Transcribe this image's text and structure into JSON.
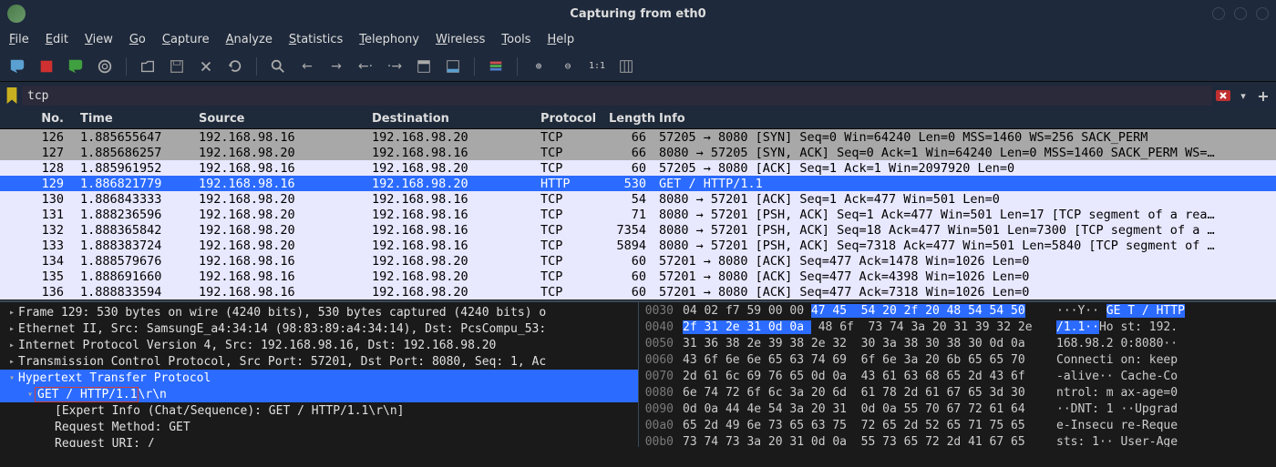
{
  "window_title": "Capturing from eth0",
  "menu": [
    "File",
    "Edit",
    "View",
    "Go",
    "Capture",
    "Analyze",
    "Statistics",
    "Telephony",
    "Wireless",
    "Tools",
    "Help"
  ],
  "menu_accel": [
    "F",
    "E",
    "V",
    "G",
    "C",
    "A",
    "S",
    "T",
    "W",
    "T",
    "H"
  ],
  "filter_value": "tcp",
  "columns": [
    "No.",
    "Time",
    "Source",
    "Destination",
    "Protocol",
    "Length",
    "Info"
  ],
  "packets": [
    {
      "no": "126",
      "time": "1.885655647",
      "src": "192.168.98.16",
      "dst": "192.168.98.20",
      "proto": "TCP",
      "len": "66",
      "info": "57205 → 8080 [SYN] Seq=0 Win=64240 Len=0 MSS=1460 WS=256 SACK_PERM",
      "cls": "bg-gray"
    },
    {
      "no": "127",
      "time": "1.885686257",
      "src": "192.168.98.20",
      "dst": "192.168.98.16",
      "proto": "TCP",
      "len": "66",
      "info": "8080 → 57205 [SYN, ACK] Seq=0 Ack=1 Win=64240 Len=0 MSS=1460 SACK_PERM WS=…",
      "cls": "bg-gray"
    },
    {
      "no": "128",
      "time": "1.885961952",
      "src": "192.168.98.16",
      "dst": "192.168.98.20",
      "proto": "TCP",
      "len": "60",
      "info": "57205 → 8080 [ACK] Seq=1 Ack=1 Win=2097920 Len=0",
      "cls": "bg-lav"
    },
    {
      "no": "129",
      "time": "1.886821779",
      "src": "192.168.98.16",
      "dst": "192.168.98.20",
      "proto": "HTTP",
      "len": "530",
      "info": "GET / HTTP/1.1 ",
      "cls": "bg-sel"
    },
    {
      "no": "130",
      "time": "1.886843333",
      "src": "192.168.98.20",
      "dst": "192.168.98.16",
      "proto": "TCP",
      "len": "54",
      "info": "8080 → 57201 [ACK] Seq=1 Ack=477 Win=501 Len=0",
      "cls": "bg-lav"
    },
    {
      "no": "131",
      "time": "1.888236596",
      "src": "192.168.98.20",
      "dst": "192.168.98.16",
      "proto": "TCP",
      "len": "71",
      "info": "8080 → 57201 [PSH, ACK] Seq=1 Ack=477 Win=501 Len=17 [TCP segment of a rea…",
      "cls": "bg-lav"
    },
    {
      "no": "132",
      "time": "1.888365842",
      "src": "192.168.98.20",
      "dst": "192.168.98.16",
      "proto": "TCP",
      "len": "7354",
      "info": "8080 → 57201 [PSH, ACK] Seq=18 Ack=477 Win=501 Len=7300 [TCP segment of a …",
      "cls": "bg-lav"
    },
    {
      "no": "133",
      "time": "1.888383724",
      "src": "192.168.98.20",
      "dst": "192.168.98.16",
      "proto": "TCP",
      "len": "5894",
      "info": "8080 → 57201 [PSH, ACK] Seq=7318 Ack=477 Win=501 Len=5840 [TCP segment of …",
      "cls": "bg-lav"
    },
    {
      "no": "134",
      "time": "1.888579676",
      "src": "192.168.98.16",
      "dst": "192.168.98.20",
      "proto": "TCP",
      "len": "60",
      "info": "57201 → 8080 [ACK] Seq=477 Ack=1478 Win=1026 Len=0",
      "cls": "bg-lav"
    },
    {
      "no": "135",
      "time": "1.888691660",
      "src": "192.168.98.16",
      "dst": "192.168.98.20",
      "proto": "TCP",
      "len": "60",
      "info": "57201 → 8080 [ACK] Seq=477 Ack=4398 Win=1026 Len=0",
      "cls": "bg-lav"
    },
    {
      "no": "136",
      "time": "1.888833594",
      "src": "192.168.98.16",
      "dst": "192.168.98.20",
      "proto": "TCP",
      "len": "60",
      "info": "57201 → 8080 [ACK] Seq=477 Ack=7318 Win=1026 Len=0",
      "cls": "bg-lav"
    }
  ],
  "details": [
    {
      "indent": 0,
      "tri": "▸",
      "text": "Frame 129: 530 bytes on wire (4240 bits), 530 bytes captured (4240 bits) o",
      "sel": false
    },
    {
      "indent": 0,
      "tri": "▸",
      "text": "Ethernet II, Src: SamsungE_a4:34:14 (98:83:89:a4:34:14), Dst: PcsCompu_53:",
      "sel": false
    },
    {
      "indent": 0,
      "tri": "▸",
      "text": "Internet Protocol Version 4, Src: 192.168.98.16, Dst: 192.168.98.20",
      "sel": false
    },
    {
      "indent": 0,
      "tri": "▸",
      "text": "Transmission Control Protocol, Src Port: 57201, Dst Port: 8080, Seq: 1, Ac",
      "sel": false
    },
    {
      "indent": 0,
      "tri": "▾",
      "text": "Hypertext Transfer Protocol",
      "sel": true,
      "hl": true
    },
    {
      "indent": 1,
      "tri": "▾",
      "text": "GET / HTTP/1.1\\r\\n",
      "sel": true,
      "hl": false,
      "red": true
    },
    {
      "indent": 2,
      "tri": "",
      "text": "[Expert Info (Chat/Sequence): GET / HTTP/1.1\\r\\n]",
      "sel": false
    },
    {
      "indent": 2,
      "tri": "",
      "text": "Request Method: GET",
      "sel": false
    },
    {
      "indent": 2,
      "tri": "",
      "text": "Request URI: /",
      "sel": false
    }
  ],
  "hex": [
    {
      "off": "0030",
      "b0": "04 02 f7 59 00 00 ",
      "bs": "47 45  54 20 2f 20 48 54 54 50",
      "a0": "···Y·· ",
      "as": "GE T / HTTP"
    },
    {
      "off": "0040",
      "b0": "",
      "bs": "2f 31 2e 31 0d 0a ",
      "b2": "48 6f  73 74 3a 20 31 39 32 2e",
      "a0": "",
      "as": "/1.1··",
      "a2": "Ho st: 192."
    },
    {
      "off": "0050",
      "b0": "31 36 38 2e 39 38 2e 32  30 3a 38 30 38 30 0d 0a",
      "a0": "168.98.2 0:8080··"
    },
    {
      "off": "0060",
      "b0": "43 6f 6e 6e 65 63 74 69  6f 6e 3a 20 6b 65 65 70",
      "a0": "Connecti on: keep"
    },
    {
      "off": "0070",
      "b0": "2d 61 6c 69 76 65 0d 0a  43 61 63 68 65 2d 43 6f",
      "a0": "-alive·· Cache-Co"
    },
    {
      "off": "0080",
      "b0": "6e 74 72 6f 6c 3a 20 6d  61 78 2d 61 67 65 3d 30",
      "a0": "ntrol: m ax-age=0"
    },
    {
      "off": "0090",
      "b0": "0d 0a 44 4e 54 3a 20 31  0d 0a 55 70 67 72 61 64",
      "a0": "··DNT: 1 ··Upgrad"
    },
    {
      "off": "00a0",
      "b0": "65 2d 49 6e 73 65 63 75  72 65 2d 52 65 71 75 65",
      "a0": "e-Insecu re-Reque"
    },
    {
      "off": "00b0",
      "b0": "73 74 73 3a 20 31 0d 0a  55 73 65 72 2d 41 67 65",
      "a0": "sts: 1·· User-Age"
    }
  ]
}
